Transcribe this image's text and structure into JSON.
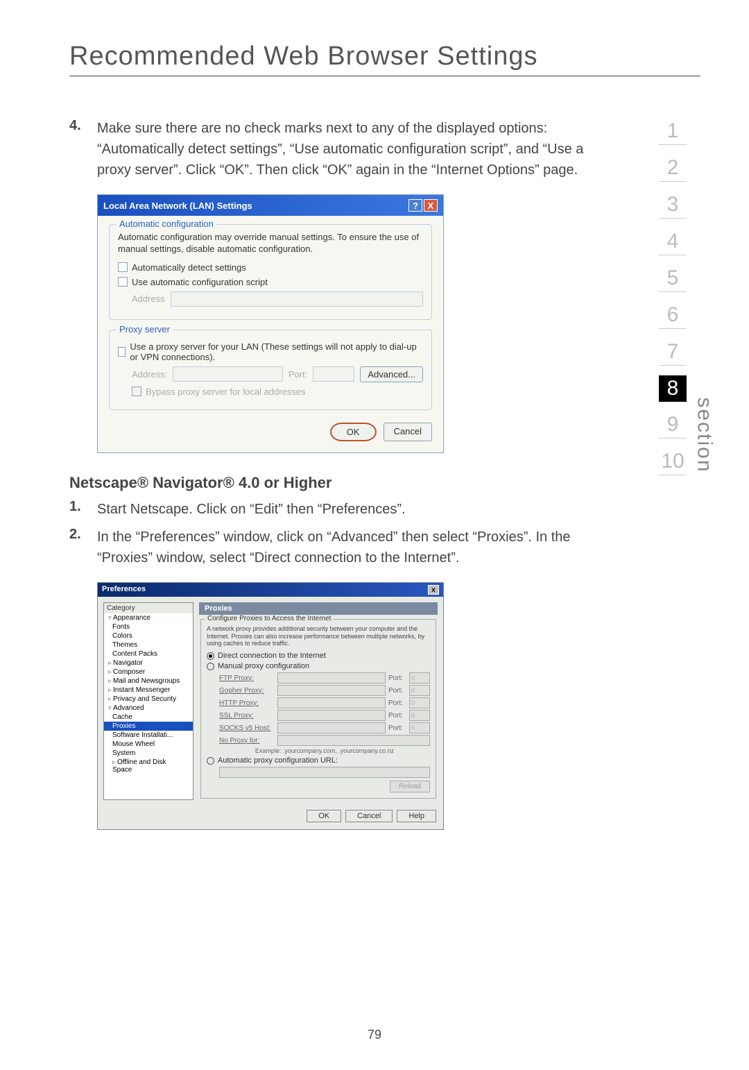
{
  "page_title": "Recommended Web Browser Settings",
  "page_number": "79",
  "section_label": "section",
  "sections": [
    "1",
    "2",
    "3",
    "4",
    "5",
    "6",
    "7",
    "8",
    "9",
    "10"
  ],
  "active_section": "8",
  "step4": {
    "num": "4.",
    "text": "Make sure there are no check marks next to any of the displayed options: “Automatically detect settings”, “Use automatic configuration script”, and “Use a proxy server”. Click “OK”. Then click “OK” again in the “Internet Options” page."
  },
  "lan_dialog": {
    "title": "Local Area Network (LAN) Settings",
    "auto_conf": {
      "legend": "Automatic configuration",
      "desc": "Automatic configuration may override manual settings.  To ensure the use of manual settings, disable automatic configuration.",
      "chk_auto_detect": "Automatically detect settings",
      "chk_auto_script": "Use automatic configuration script",
      "address_label": "Address"
    },
    "proxy": {
      "legend": "Proxy server",
      "chk_proxy": "Use a proxy server for your LAN (These settings will not apply to dial-up or VPN connections).",
      "address_label": "Address:",
      "port_label": "Port:",
      "advanced": "Advanced...",
      "chk_bypass": "Bypass proxy server for local addresses"
    },
    "ok": "OK",
    "cancel": "Cancel",
    "help_icon": "?",
    "close_icon": "X"
  },
  "netscape_heading": "Netscape® Navigator® 4.0 or Higher",
  "netscape_steps": [
    {
      "num": "1.",
      "text": "Start Netscape. Click on “Edit” then “Preferences”."
    },
    {
      "num": "2.",
      "text": "In the “Preferences” window, click on “Advanced” then select “Proxies”. In the “Proxies” window, select “Direct connection to the Internet”."
    }
  ],
  "prefs_dialog": {
    "title": "Preferences",
    "close_icon": "x",
    "category_label": "Category",
    "categories": {
      "appearance": "Appearance",
      "appearance_children": [
        "Fonts",
        "Colors",
        "Themes",
        "Content Packs"
      ],
      "navigator": "Navigator",
      "composer": "Composer",
      "mail": "Mail and Newsgroups",
      "im": "Instant Messenger",
      "privacy": "Privacy and Security",
      "advanced": "Advanced",
      "advanced_children": [
        "Cache",
        "Proxies",
        "Software Installati...",
        "Mouse Wheel",
        "System"
      ],
      "offline": "Offline and Disk Space"
    },
    "proxies_heading": "Proxies",
    "fieldset_legend": "Configure Proxies to Access the Internet",
    "desc": "A network proxy provides additional security between your computer and the Internet. Proxies can also increase performance between multiple networks, by using caches to reduce traffic.",
    "radio_direct": "Direct connection to the Internet",
    "radio_manual": "Manual proxy configuration",
    "proxies": [
      {
        "label": "FTP Proxy:"
      },
      {
        "label": "Gopher Proxy:"
      },
      {
        "label": "HTTP Proxy:"
      },
      {
        "label": "SSL Proxy:"
      },
      {
        "label": "SOCKS v5 Host:"
      }
    ],
    "port_label": "Port:",
    "port_default": "0",
    "no_proxy_label": "No Proxy for:",
    "example": "Example: .yourcompany.com, .yourcompany.co.nz",
    "radio_auto": "Automatic proxy configuration URL:",
    "reload": "Reload",
    "ok": "OK",
    "cancel": "Cancel",
    "help": "Help"
  }
}
